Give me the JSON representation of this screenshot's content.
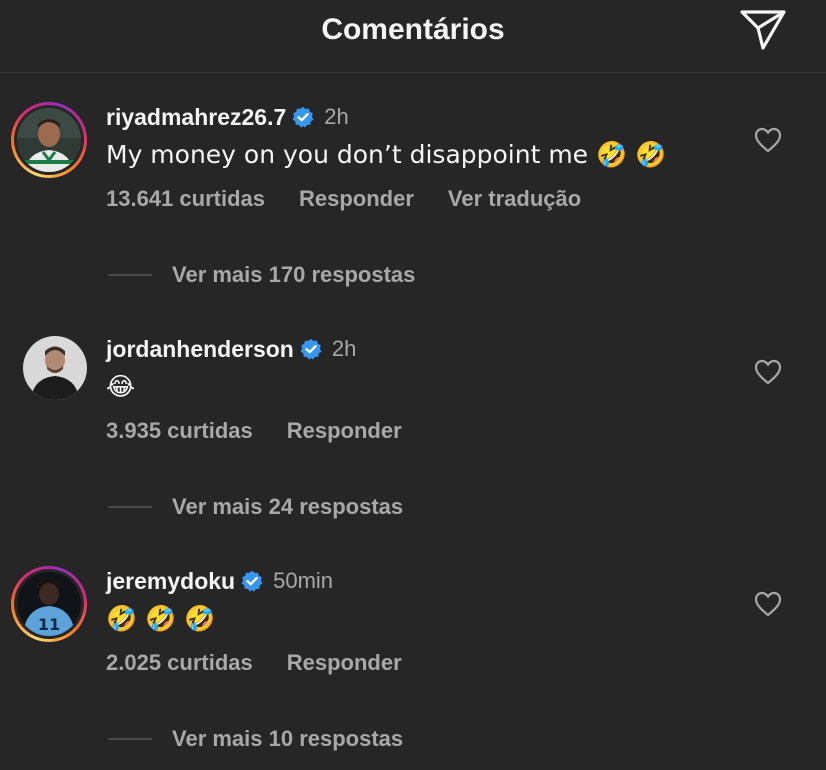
{
  "header": {
    "title": "Comentários",
    "send_icon": "paper-plane-icon"
  },
  "colors": {
    "background": "#262626",
    "text": "#f5f5f5",
    "muted": "#a8a8a8",
    "verified": "#3797f0"
  },
  "comments": [
    {
      "username": "riyadmahrez26.7",
      "verified": true,
      "time": "2h",
      "text": "My money on you don’t disappoint me 🤣 🤣",
      "likes": "13.641 curtidas",
      "reply_label": "Responder",
      "translate_label": "Ver tradução",
      "more_replies": "Ver mais 170 respostas",
      "has_story": true,
      "avatar_icon": "player-green-jersey-avatar"
    },
    {
      "username": "jordanhenderson",
      "verified": true,
      "time": "2h",
      "text": "😂",
      "likes": "3.935 curtidas",
      "reply_label": "Responder",
      "more_replies": "Ver mais 24 respostas",
      "has_story": false,
      "avatar_icon": "person-dark-jacket-avatar"
    },
    {
      "username": "jeremydoku",
      "verified": true,
      "time": "50min",
      "text": "🤣 🤣 🤣",
      "likes": "2.025 curtidas",
      "reply_label": "Responder",
      "more_replies": "Ver mais 10 respostas",
      "has_story": true,
      "avatar_icon": "player-number-11-avatar"
    }
  ]
}
